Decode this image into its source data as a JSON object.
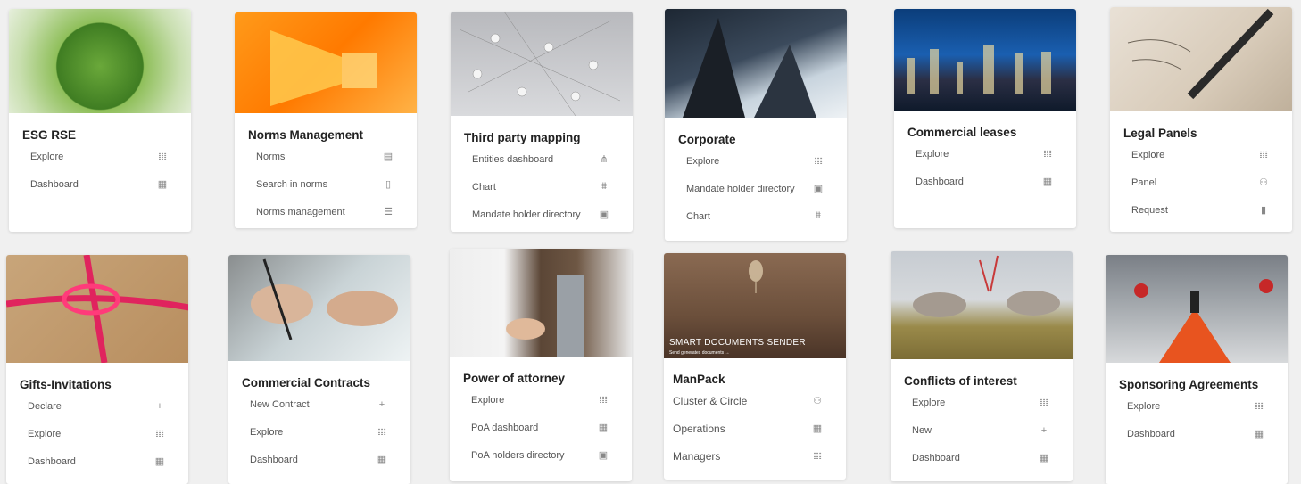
{
  "cards": [
    {
      "title": "ESG RSE",
      "items": [
        {
          "label": "Explore",
          "icon": "library-icon",
          "glyph": "𝍖"
        },
        {
          "label": "Dashboard",
          "icon": "dashboard-icon",
          "glyph": "▦"
        }
      ]
    },
    {
      "title": "Norms Management",
      "items": [
        {
          "label": "Norms",
          "icon": "book-icon",
          "glyph": "▤"
        },
        {
          "label": "Search in norms",
          "icon": "document-icon",
          "glyph": "▯"
        },
        {
          "label": "Norms management",
          "icon": "list-icon",
          "glyph": "☰"
        }
      ]
    },
    {
      "title": "Third party mapping",
      "items": [
        {
          "label": "Entities dashboard",
          "icon": "hierarchy-icon",
          "glyph": "⋔"
        },
        {
          "label": "Chart",
          "icon": "org-chart-icon",
          "glyph": "⩩"
        },
        {
          "label": "Mandate holder directory",
          "icon": "contact-card-icon",
          "glyph": "▣"
        }
      ]
    },
    {
      "title": "Corporate",
      "items": [
        {
          "label": "Explore",
          "icon": "library-icon",
          "glyph": "𝍖"
        },
        {
          "label": "Mandate holder directory",
          "icon": "contact-card-icon",
          "glyph": "▣"
        },
        {
          "label": "Chart",
          "icon": "org-chart-icon",
          "glyph": "⩩"
        }
      ]
    },
    {
      "title": "Commercial leases",
      "items": [
        {
          "label": "Explore",
          "icon": "library-icon",
          "glyph": "𝍖"
        },
        {
          "label": "Dashboard",
          "icon": "dashboard-icon",
          "glyph": "▦"
        }
      ]
    },
    {
      "title": "Legal Panels",
      "items": [
        {
          "label": "Explore",
          "icon": "library-icon",
          "glyph": "𝍖"
        },
        {
          "label": "Panel",
          "icon": "group-icon",
          "glyph": "⚇"
        },
        {
          "label": "Request",
          "icon": "file-icon",
          "glyph": "▮"
        }
      ]
    },
    {
      "title": "Gifts-Invitations",
      "items": [
        {
          "label": "Declare",
          "icon": "plus-icon",
          "glyph": "+"
        },
        {
          "label": "Explore",
          "icon": "library-icon",
          "glyph": "𝍖"
        },
        {
          "label": "Dashboard",
          "icon": "dashboard-icon",
          "glyph": "▦"
        }
      ]
    },
    {
      "title": "Commercial Contracts",
      "items": [
        {
          "label": "New Contract",
          "icon": "plus-icon",
          "glyph": "+"
        },
        {
          "label": "Explore",
          "icon": "library-icon",
          "glyph": "𝍖"
        },
        {
          "label": "Dashboard",
          "icon": "dashboard-icon",
          "glyph": "▦"
        }
      ]
    },
    {
      "title": "Power of attorney",
      "items": [
        {
          "label": "Explore",
          "icon": "library-icon",
          "glyph": "𝍖"
        },
        {
          "label": "PoA dashboard",
          "icon": "dashboard-icon",
          "glyph": "▦"
        },
        {
          "label": "PoA holders directory",
          "icon": "contact-card-icon",
          "glyph": "▣"
        }
      ]
    },
    {
      "title": "ManPack",
      "image_caption": "SMART DOCUMENTS SENDER",
      "image_subcaption": "Send generates documents →",
      "items": [
        {
          "label": "Cluster & Circle",
          "icon": "group-icon",
          "glyph": "⚇"
        },
        {
          "label": "Operations",
          "icon": "dashboard-icon",
          "glyph": "▦"
        },
        {
          "label": "Managers",
          "icon": "library-icon",
          "glyph": "𝍖"
        }
      ]
    },
    {
      "title": "Conflicts of interest",
      "items": [
        {
          "label": "Explore",
          "icon": "library-icon",
          "glyph": "𝍖"
        },
        {
          "label": "New",
          "icon": "plus-icon",
          "glyph": "+"
        },
        {
          "label": "Dashboard",
          "icon": "dashboard-icon",
          "glyph": "▦"
        }
      ]
    },
    {
      "title": "Sponsoring Agreements",
      "items": [
        {
          "label": "Explore",
          "icon": "library-icon",
          "glyph": "𝍖"
        },
        {
          "label": "Dashboard",
          "icon": "dashboard-icon",
          "glyph": "▦"
        }
      ]
    }
  ]
}
